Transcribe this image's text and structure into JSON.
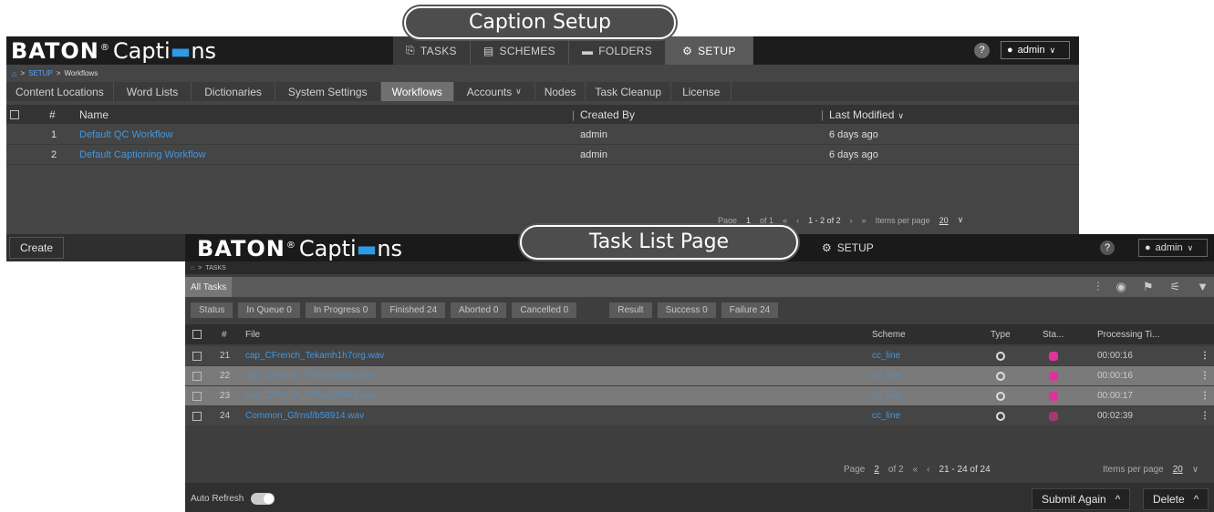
{
  "callouts": {
    "setup": "Caption Setup",
    "tasklist": "Task List Page"
  },
  "screen1": {
    "logo": {
      "bold": "BATON",
      "reg": "®",
      "text_before": "Capti",
      "text_after": "ns"
    },
    "nav": [
      {
        "icon": "tasks-icon",
        "glyph": "⎘",
        "label": "TASKS"
      },
      {
        "icon": "schemes-icon",
        "glyph": "▤",
        "label": "SCHEMES"
      },
      {
        "icon": "folder-icon",
        "glyph": "▬",
        "label": "FOLDERS"
      },
      {
        "icon": "gear-icon",
        "glyph": "⚙",
        "label": "SETUP"
      }
    ],
    "help": "?",
    "user": "admin",
    "breadcrumb": {
      "home": "⌂",
      "sep": ">",
      "a": "SETUP",
      "b": "Workflows"
    },
    "subtabs": [
      "Content Locations",
      "Word Lists",
      "Dictionaries",
      "System Settings",
      "Workflows",
      "Accounts",
      "Nodes",
      "Task Cleanup",
      "License"
    ],
    "table": {
      "headers": {
        "num": "#",
        "name": "Name",
        "created": "Created By",
        "modified": "Last Modified"
      },
      "rows": [
        {
          "num": "1",
          "name": "Default QC Workflow",
          "created": "admin",
          "modified": "6 days ago"
        },
        {
          "num": "2",
          "name": "Default Captioning Workflow",
          "created": "admin",
          "modified": "6 days ago"
        }
      ]
    },
    "pager": {
      "page_label": "Page",
      "page": "1",
      "of": "of 1",
      "first": "«",
      "prev": "‹",
      "range": "1 - 2 of 2",
      "next": "›",
      "last": "»",
      "ipp_label": "Items per page",
      "ipp": "20"
    },
    "create": "Create"
  },
  "screen2": {
    "logo": {
      "bold": "BATON",
      "text_before": "Capti",
      "text_after": "ns"
    },
    "setup": "SETUP",
    "help": "?",
    "user": "admin",
    "breadcrumb": {
      "home": "⌂",
      "sep": ">",
      "a": "TASKS"
    },
    "tab": "All Tasks",
    "toolbar_icons": [
      "chart-icon",
      "status-icon",
      "flag-icon",
      "filter-settings-icon",
      "filter-icon"
    ],
    "filters": {
      "status": "Status",
      "chips": [
        "In Queue 0",
        "In Progress 0",
        "Finished 24",
        "Aborted 0",
        "Cancelled 0"
      ],
      "result": "Result",
      "chips2": [
        "Success 0",
        "Failure 24"
      ]
    },
    "headers": {
      "num": "#",
      "file": "File",
      "scheme": "Scheme",
      "type": "Type",
      "status": "Sta...",
      "proc": "Processing Ti..."
    },
    "rows": [
      {
        "num": "21",
        "file": "cap_CFrench_Tekamh1h7org.wav",
        "scheme": "cc_line",
        "time": "00:00:16"
      },
      {
        "num": "22",
        "file": "cap_CFrench_Tb9mNb9k4.wav",
        "scheme": "cc_line",
        "time": "00:00:16"
      },
      {
        "num": "23",
        "file": "cap_CFrench_0h6mp2b8kd.wav",
        "scheme": "cc_line",
        "time": "00:00:17"
      },
      {
        "num": "24",
        "file": "Common_Gfrnsf/b58914.wav",
        "scheme": "cc_line",
        "time": "00:02:39"
      }
    ],
    "pager": {
      "page_label": "Page",
      "page": "2",
      "of": "of 2",
      "first": "«",
      "prev": "‹",
      "range": "21 - 24 of 24",
      "ipp_label": "Items per page",
      "ipp": "20"
    },
    "footer": {
      "auto_refresh": "Auto Refresh",
      "submit": "Submit Again",
      "delete": "Delete",
      "caret": "^"
    }
  }
}
